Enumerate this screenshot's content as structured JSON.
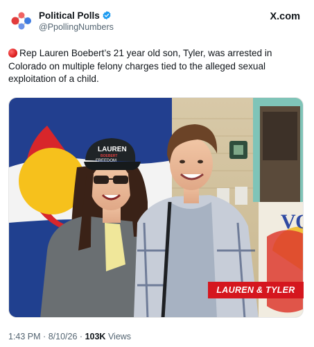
{
  "account": {
    "display_name": "Political Polls",
    "handle": "@PpollingNumbers",
    "verified": true,
    "avatar_icon": "political-polls-logo-icon"
  },
  "platform": {
    "logo_text": "X.com",
    "logo_icon": "x-logo-icon"
  },
  "tweet": {
    "emoji_icon": "red-circle-icon",
    "text": "Rep Lauren Boebert’s 21 year old son, Tyler, was arrested in Colorado on multiple felony charges tied to the alleged sexual exploitation of a child."
  },
  "media": {
    "caption": "LAUREN & TYLER",
    "cap_text_line1": "LAUREN",
    "cap_text_line2": "BOEBERT",
    "cap_text_line3": "FREEDOM",
    "sign_text": "VO",
    "caption_color": "#d5161e"
  },
  "meta": {
    "time": "1:43 PM",
    "separator": "·",
    "date": "8/10/26",
    "views_count": "103K",
    "views_label": "Views"
  },
  "colors": {
    "text_primary": "#0f1419",
    "text_secondary": "#536471",
    "verified_blue": "#1d9bf0"
  }
}
